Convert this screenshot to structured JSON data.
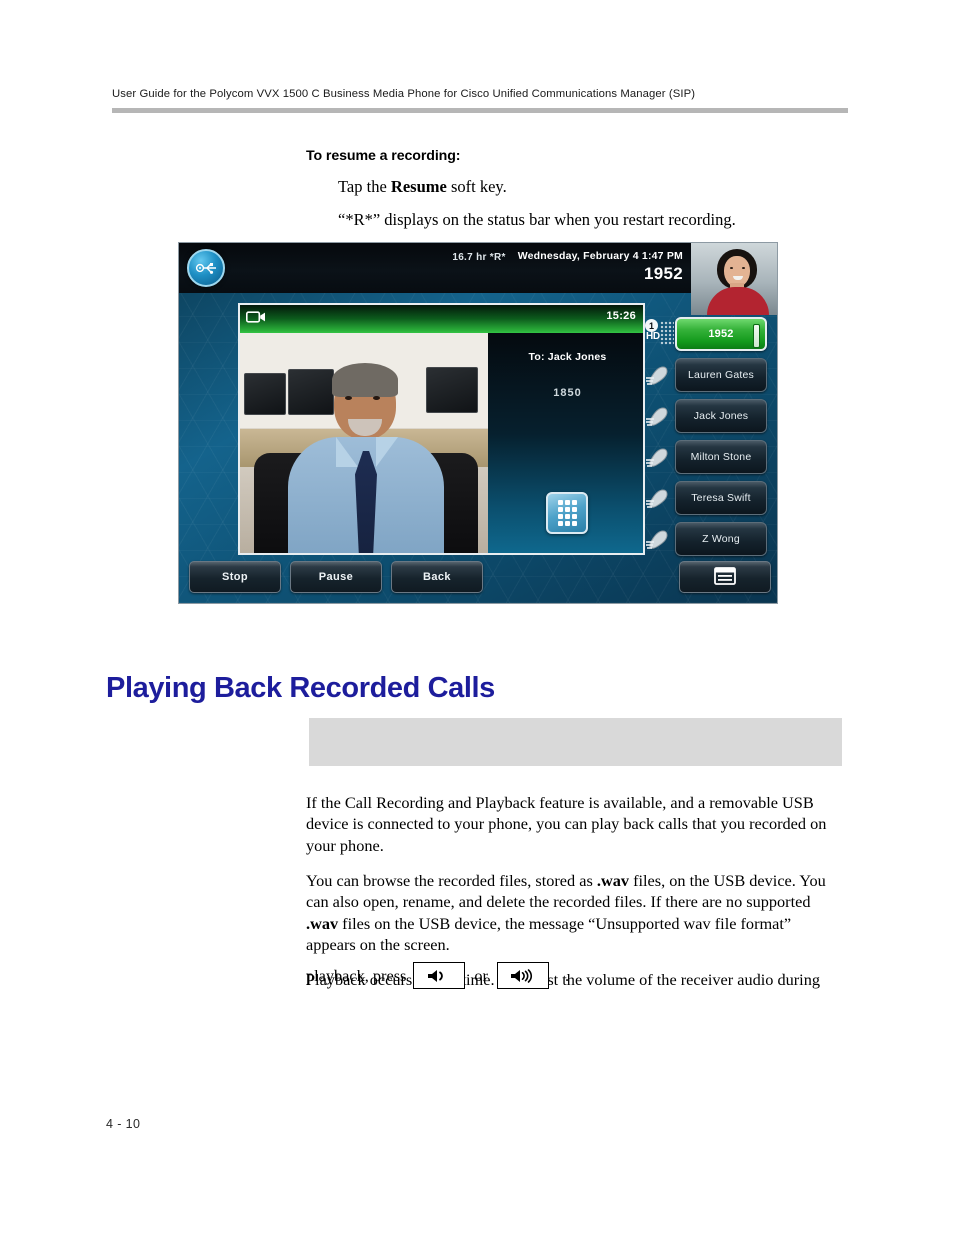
{
  "header": {
    "running_head": "User Guide for the Polycom VVX 1500 C Business Media Phone for Cisco Unified Communications Manager (SIP)"
  },
  "procedure": {
    "title": "To resume a recording:",
    "steps": [
      "Tap the Resume soft key.",
      "“*R*” displays on the status bar when you restart recording."
    ],
    "step1_prefix": "Tap the ",
    "step1_bold": "Resume",
    "step1_suffix": " soft key.",
    "step2": "“*R*” displays on the status bar when you restart recording."
  },
  "phone_screen": {
    "status_bar": {
      "usb_icon": "usb-icon",
      "recording_status": "16.7 hr *R*",
      "datetime": "Wednesday, February 4  1:47 PM",
      "my_extension": "1952"
    },
    "call_window": {
      "video_icon": "video-camera-icon",
      "call_timer": "15:26",
      "info": {
        "to_label": "To: Jack Jones",
        "blank_line": "",
        "extension": "1850"
      },
      "dialpad_icon": "dialpad-icon"
    },
    "line_keys": [
      {
        "label": "1952",
        "icon": "hd-line-icon",
        "badge_number": "1",
        "badge_text": "HD",
        "active": true
      },
      {
        "label": "Lauren Gates",
        "icon": "handset-icon",
        "active": false
      },
      {
        "label": "Jack Jones",
        "icon": "handset-icon",
        "active": false
      },
      {
        "label": "Milton Stone",
        "icon": "handset-icon",
        "active": false
      },
      {
        "label": "Teresa Swift",
        "icon": "handset-icon",
        "active": false
      },
      {
        "label": "Z Wong",
        "icon": "handset-icon",
        "active": false
      }
    ],
    "soft_keys": [
      {
        "label": "Stop"
      },
      {
        "label": "Pause"
      },
      {
        "label": "Back"
      },
      {
        "label": "",
        "icon": "menu-list-icon"
      }
    ],
    "colors": {
      "active_line_green": "#2bb13a",
      "call_bar_green": "#34c445",
      "wallpaper_blue": "#14638c"
    }
  },
  "section": {
    "heading": "Playing Back Recorded Calls",
    "heading_color": "#1d1d9c"
  },
  "note_box": {
    "text": ""
  },
  "body": {
    "paragraph_1": "If the Call Recording and Playback feature is available, and a removable USB device is connected to your phone, you can play back calls that you recorded on your phone.",
    "paragraph_2_part1": "You can browse the recorded files, stored as ",
    "paragraph_2_bold1": ".wav",
    "paragraph_2_part2": " files, on the USB device. You can also open, rename, and delete the recorded files. If there are no supported ",
    "paragraph_2_bold2": ".wav",
    "paragraph_2_part3": " files on the USB device, the message “Unsupported wav file format” appears on the screen.",
    "paragraph_3_line1": "Playback occurs in real time. To adjust the volume of the receiver audio during",
    "paragraph_3_prefix": "playback, press",
    "paragraph_3_or": "or",
    "paragraph_3_suffix": ".",
    "volume_down_icon": "volume-down-icon",
    "volume_up_icon": "volume-up-icon"
  },
  "footer": {
    "page_number": "4 - 10"
  }
}
